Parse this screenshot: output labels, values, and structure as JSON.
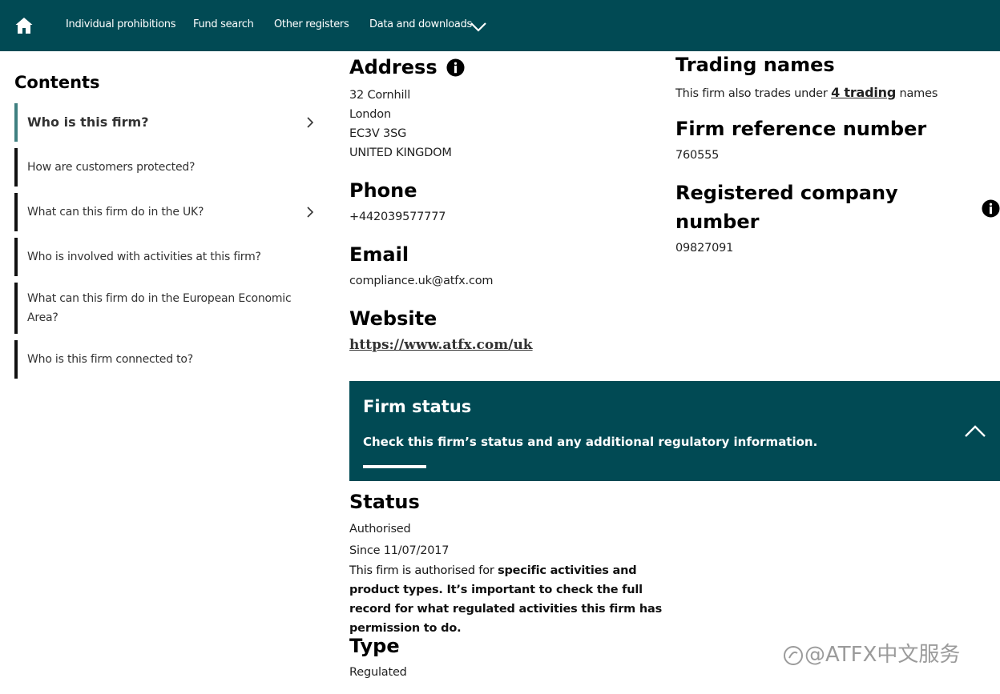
{
  "nav": {
    "home_icon": "home-icon",
    "items": [
      "Individual prohibitions",
      "Fund search",
      "Other registers",
      "Data and downloads"
    ]
  },
  "sidebar": {
    "title": "Contents",
    "items": [
      {
        "label": "Who is this firm?",
        "active": true,
        "chevron": true
      },
      {
        "label": "How are customers protected?",
        "active": false,
        "chevron": false
      },
      {
        "label": "What can this firm do in the UK?",
        "active": false,
        "chevron": true
      },
      {
        "label": "Who is involved with activities at this firm?",
        "active": false,
        "chevron": false
      },
      {
        "label": "What can this firm do in the European Economic Area?",
        "active": false,
        "chevron": false
      },
      {
        "label": "Who is this firm connected to?",
        "active": false,
        "chevron": false
      }
    ]
  },
  "address": {
    "heading": "Address",
    "lines": [
      "32 Cornhill",
      "London",
      "EC3V 3SG",
      "UNITED KINGDOM"
    ]
  },
  "phone": {
    "heading": "Phone",
    "value": "+442039577777"
  },
  "email": {
    "heading": "Email",
    "value": "compliance.uk@atfx.com"
  },
  "website": {
    "heading": "Website",
    "value": "https://www.atfx.com/uk"
  },
  "trading_names": {
    "heading": "Trading names",
    "prefix": "This firm also trades under ",
    "link": "4 trading",
    "suffix": " names"
  },
  "frn": {
    "heading": "Firm reference number",
    "value": "760555"
  },
  "company_number": {
    "heading_line1": "Registered company",
    "heading_line2": "number",
    "value": "09827091"
  },
  "firm_status": {
    "title": "Firm status",
    "subtitle": "Check this firm’s status and any additional regulatory information."
  },
  "status": {
    "heading": "Status",
    "value": "Authorised",
    "since": "Since 11/07/2017",
    "para_plain": "This firm is authorised for ",
    "para_bold": "specific activities and product types. It’s important to check the full record for what regulated activities this firm has permission to do."
  },
  "type": {
    "heading": "Type",
    "value": "Regulated"
  },
  "watermark": "@ATFX中文服务",
  "colors": {
    "header_bg": "#014a54",
    "active_border": "#3f7f80",
    "text": "#111111"
  }
}
